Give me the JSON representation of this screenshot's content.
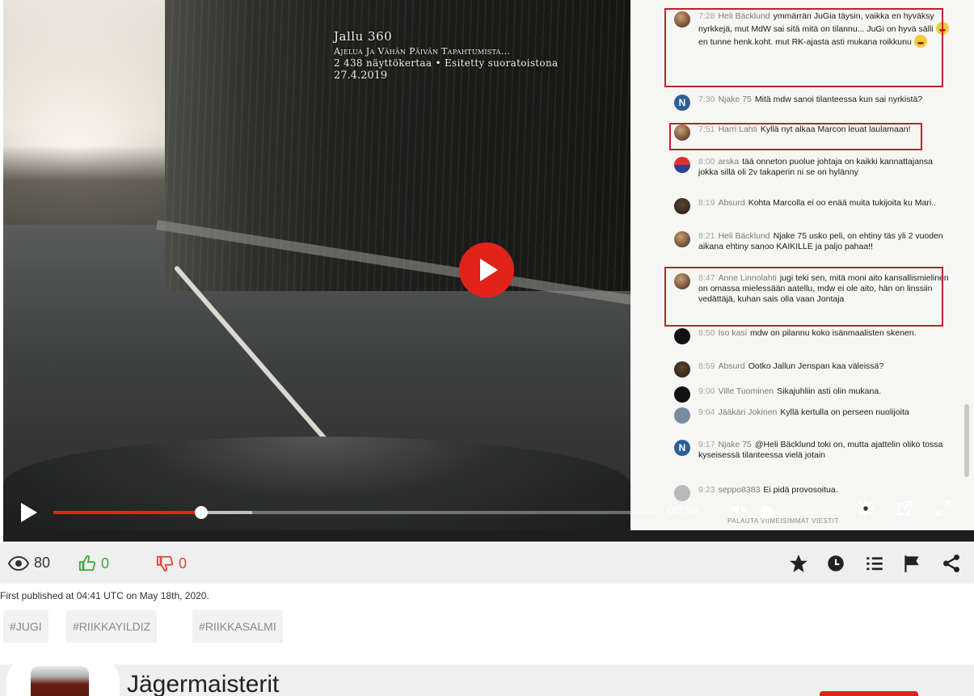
{
  "video": {
    "overlay": {
      "line1": "Jallu 360",
      "line2": "Ajelua Ja Vähän Päivän Tapahtumista...",
      "line3": "2 438 näyttökertaa • Esitetty suoratoistona",
      "line4": "27.4.2019"
    },
    "chat": [
      {
        "time": "7:28",
        "author": "Heli Bäcklund",
        "text": "ymmärrän JuGia täysin, vaikka en hyväksy nyrkkejä, mut MdW sai sitä mitä on tilannu... JuGi on hyvä sälli",
        "text2": "en tunne henk.koht. mut RK-ajasta asti mukana roikkunu",
        "avatar": "brown",
        "highlighted": true
      },
      {
        "time": "7:30",
        "author": "Njake 75",
        "text": "Mitä mdw sanoi tilanteessa kun sai nyrkistä?",
        "avatar": "n"
      },
      {
        "time": "7:51",
        "author": "Harri Lahti",
        "text": "Kyllä nyt alkaa Marcon leuat laulamaan!",
        "avatar": "brown",
        "highlighted": true
      },
      {
        "time": "8:00",
        "author": "arska",
        "text": "tää onneton puolue johtaja on kaikki kannattajansa jokka sillä oli 2v takaperin ni se on hylänny",
        "avatar": "flag"
      },
      {
        "time": "8:19",
        "author": "Absurd",
        "text": "Kohta Marcolla ei oo enää muita tukijoita ku Mari..",
        "avatar": "dark"
      },
      {
        "time": "8:21",
        "author": "Heli Bäcklund",
        "text": "Njake 75 usko peli, on ehtiny täs yli 2 vuoden aikana ehtiny sanoo KAIKILLE ja paljo pahaa!!",
        "avatar": "brown"
      },
      {
        "time": "8:47",
        "author": "Anne Linnolahti",
        "text": "jugi teki sen, mitä moni aito kansallismielinen on omassa mielessään aatellu, mdw ei ole aito, hän on linssiin vedättäjä, kuhan sais olla vaan Jontaja",
        "avatar": "brown",
        "highlighted": true
      },
      {
        "time": "8:50",
        "author": "Iso kasi",
        "text": "mdw on pilannu koko isänmaalisten skenen.",
        "avatar": "black"
      },
      {
        "time": "8:59",
        "author": "Absurd",
        "text": "Ootko Jallun Jenspan kaa väleissä?",
        "avatar": "dark"
      },
      {
        "time": "9:00",
        "author": "Ville Tuominen",
        "text": "Sikajuhliin asti olin mukana.",
        "avatar": "black"
      },
      {
        "time": "9:04",
        "author": "Jääkäri Jokinen",
        "text": "Kyllä kertulla on perseen nuolijoita",
        "avatar": "user"
      },
      {
        "time": "9:17",
        "author": "Njake 75",
        "text": "@Heli Bäcklund toki on, mutta ajattelin oliko tossa kyseisessä tilanteessa vielä jotain",
        "avatar": "n"
      },
      {
        "time": "9:23",
        "author": "seppo8383",
        "text": "Ei pidä provosoitua.",
        "avatar": "gray"
      }
    ],
    "chat_footer": "PALAUTA VIIMEISIMMAT VIESTIT",
    "progress": {
      "played": 0.245,
      "buffered": 0.33
    },
    "volume": 0.0,
    "time": "00:59",
    "colors": {
      "accent": "#e2231a",
      "highlight": "#c0222a"
    }
  },
  "stats": {
    "views": "80",
    "likes": "0",
    "dislikes": "0"
  },
  "published": "First published at 04:41 UTC on May 18th, 2020.",
  "tags": [
    "#JUGI",
    "#RIIKKAYILDIZ",
    "#RIIKKASALMI"
  ],
  "channel": {
    "name": "Jägermaisterit"
  },
  "icons": {
    "views": "eye-icon",
    "likes": "thumbs-up-icon",
    "dislikes": "thumbs-down-icon",
    "favorite": "star-icon",
    "watch_later": "clock-icon",
    "playlist": "list-icon",
    "report": "flag-icon",
    "share": "share-icon",
    "mute": "volume-muted-icon",
    "settings": "gear-icon",
    "popout": "external-link-icon",
    "fullscreen": "fullscreen-icon"
  }
}
